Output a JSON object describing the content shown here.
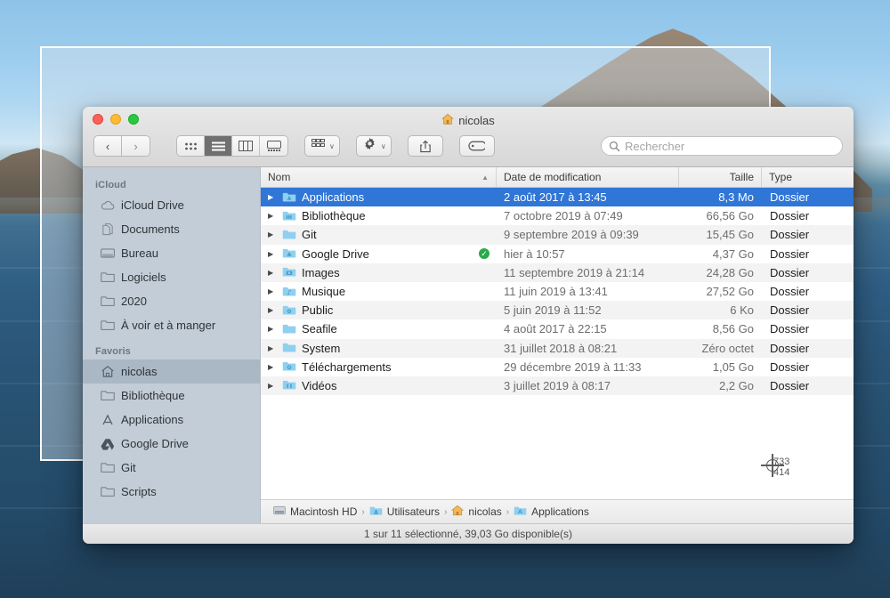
{
  "window": {
    "title": "nicolas",
    "title_icon": "home-icon",
    "traffic_lights": [
      "close",
      "minimize",
      "zoom"
    ]
  },
  "toolbar": {
    "back_label": "‹",
    "forward_label": "›",
    "view_modes": [
      {
        "name": "icon-view",
        "label": "icon",
        "active": false
      },
      {
        "name": "list-view",
        "label": "list",
        "active": true
      },
      {
        "name": "column-view",
        "label": "column",
        "active": false
      },
      {
        "name": "gallery-view",
        "label": "gallery",
        "active": false
      }
    ],
    "group_button": "group-by-icon",
    "action_button": "gear-icon",
    "share_button": "share-icon",
    "tags_button": "tag-icon",
    "chevron": "∨"
  },
  "search": {
    "placeholder": "Rechercher",
    "value": "",
    "icon": "search-icon"
  },
  "sidebar": {
    "sections": [
      {
        "header": "iCloud",
        "items": [
          {
            "label": "iCloud Drive",
            "icon": "cloud-icon",
            "selected": false
          },
          {
            "label": "Documents",
            "icon": "documents-icon",
            "selected": false
          },
          {
            "label": "Bureau",
            "icon": "desktop-icon",
            "selected": false
          },
          {
            "label": "Logiciels",
            "icon": "folder-icon",
            "selected": false
          },
          {
            "label": "2020",
            "icon": "folder-icon",
            "selected": false
          },
          {
            "label": "À voir et à manger",
            "icon": "folder-icon",
            "selected": false
          }
        ]
      },
      {
        "header": "Favoris",
        "items": [
          {
            "label": "nicolas",
            "icon": "home-icon",
            "selected": true
          },
          {
            "label": "Bibliothèque",
            "icon": "folder-icon",
            "selected": false
          },
          {
            "label": "Applications",
            "icon": "appstore-icon",
            "selected": false
          },
          {
            "label": "Google Drive",
            "icon": "google-drive-icon",
            "selected": false
          },
          {
            "label": "Git",
            "icon": "folder-icon",
            "selected": false
          },
          {
            "label": "Scripts",
            "icon": "folder-icon",
            "selected": false
          }
        ]
      }
    ]
  },
  "filelist": {
    "columns": [
      {
        "key": "name",
        "label": "Nom",
        "sorted": true,
        "sort_dir": "asc"
      },
      {
        "key": "date",
        "label": "Date de modification"
      },
      {
        "key": "size",
        "label": "Taille"
      },
      {
        "key": "type",
        "label": "Type"
      }
    ],
    "rows": [
      {
        "name": "Applications",
        "date": "2 août 2017 à 13:45",
        "size": "8,3 Mo",
        "type": "Dossier",
        "icon": "applications-folder-icon",
        "selected": true,
        "badge": null
      },
      {
        "name": "Bibliothèque",
        "date": "7 octobre 2019 à 07:49",
        "size": "66,56 Go",
        "type": "Dossier",
        "icon": "library-folder-icon",
        "selected": false,
        "badge": null
      },
      {
        "name": "Git",
        "date": "9 septembre 2019 à 09:39",
        "size": "15,45 Go",
        "type": "Dossier",
        "icon": "folder-icon",
        "selected": false,
        "badge": null
      },
      {
        "name": "Google Drive",
        "date": "hier à 10:57",
        "size": "4,37 Go",
        "type": "Dossier",
        "icon": "gdrive-folder-icon",
        "selected": false,
        "badge": "sync-ok-icon"
      },
      {
        "name": "Images",
        "date": "11 septembre 2019 à 21:14",
        "size": "24,28 Go",
        "type": "Dossier",
        "icon": "pictures-folder-icon",
        "selected": false,
        "badge": null
      },
      {
        "name": "Musique",
        "date": "11 juin 2019 à 13:41",
        "size": "27,52 Go",
        "type": "Dossier",
        "icon": "music-folder-icon",
        "selected": false,
        "badge": null
      },
      {
        "name": "Public",
        "date": "5 juin 2019 à 11:52",
        "size": "6 Ko",
        "type": "Dossier",
        "icon": "public-folder-icon",
        "selected": false,
        "badge": null
      },
      {
        "name": "Seafile",
        "date": "4 août 2017 à 22:15",
        "size": "8,56 Go",
        "type": "Dossier",
        "icon": "folder-icon",
        "selected": false,
        "badge": null
      },
      {
        "name": "System",
        "date": "31 juillet 2018 à 08:21",
        "size": "Zéro octet",
        "type": "Dossier",
        "icon": "folder-icon",
        "selected": false,
        "badge": null
      },
      {
        "name": "Téléchargements",
        "date": "29 décembre 2019 à 11:33",
        "size": "1,05 Go",
        "type": "Dossier",
        "icon": "downloads-folder-icon",
        "selected": false,
        "badge": null
      },
      {
        "name": "Vidéos",
        "date": "3 juillet 2019 à 08:17",
        "size": "2,2 Go",
        "type": "Dossier",
        "icon": "movies-folder-icon",
        "selected": false,
        "badge": null
      }
    ]
  },
  "pathbar": {
    "separator": "›",
    "crumbs": [
      {
        "label": "Macintosh HD",
        "icon": "harddisk-icon"
      },
      {
        "label": "Utilisateurs",
        "icon": "users-folder-icon"
      },
      {
        "label": "nicolas",
        "icon": "home-icon"
      },
      {
        "label": "Applications",
        "icon": "applications-folder-icon"
      }
    ]
  },
  "statusbar": {
    "text": "1 sur 11 sélectionné, 39,03 Go disponible(s)"
  },
  "cursor": {
    "type": "crosshair",
    "x_label": "733",
    "y_label": "414"
  },
  "colors": {
    "selection_blue": "#2f76d6",
    "sidebar_bg": "#c3cdd7",
    "sidebar_selected": "#aab7c4",
    "folder_blue": "#76c7ef",
    "sync_green": "#2aa84a"
  }
}
